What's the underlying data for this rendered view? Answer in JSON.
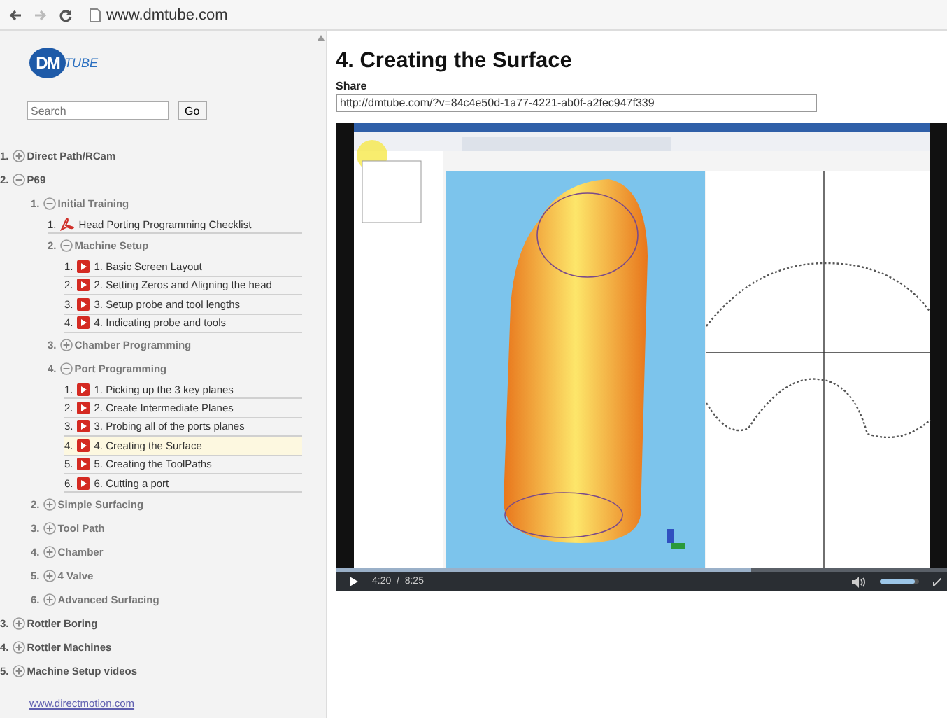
{
  "browser": {
    "url": "www.dmtube.com"
  },
  "sidebar": {
    "logo": {
      "text_1": "DM",
      "text_2": "TUBE"
    },
    "search": {
      "placeholder": "Search",
      "button": "Go"
    },
    "tree": [
      {
        "number": "1.",
        "label": "Direct Path/RCam",
        "kind": "folder",
        "expanded": false,
        "selected": false
      },
      {
        "number": "2.",
        "label": "P69",
        "kind": "folder",
        "expanded": true,
        "selected": false,
        "children": [
          {
            "number": "1.",
            "label": "Initial Training",
            "kind": "folder",
            "expanded": true,
            "selected": false,
            "children": [
              {
                "number": "1.",
                "label": "Head Porting Programming Checklist",
                "kind": "pdf",
                "selected": false
              },
              {
                "number": "2.",
                "label": "Machine Setup",
                "kind": "folder",
                "expanded": true,
                "selected": false,
                "children": [
                  {
                    "number": "1.",
                    "label": "1. Basic Screen Layout",
                    "kind": "video",
                    "selected": false
                  },
                  {
                    "number": "2.",
                    "label": "2. Setting Zeros and Aligning the head",
                    "kind": "video",
                    "selected": false
                  },
                  {
                    "number": "3.",
                    "label": "3. Setup probe and tool lengths",
                    "kind": "video",
                    "selected": false
                  },
                  {
                    "number": "4.",
                    "label": "4. Indicating probe and tools",
                    "kind": "video",
                    "selected": false
                  }
                ]
              },
              {
                "number": "3.",
                "label": "Chamber Programming",
                "kind": "folder",
                "expanded": false,
                "selected": false
              },
              {
                "number": "4.",
                "label": "Port Programming",
                "kind": "folder",
                "expanded": true,
                "selected": false,
                "children": [
                  {
                    "number": "1.",
                    "label": "1. Picking up the 3 key planes",
                    "kind": "video",
                    "selected": false
                  },
                  {
                    "number": "2.",
                    "label": "2. Create Intermediate Planes",
                    "kind": "video",
                    "selected": false
                  },
                  {
                    "number": "3.",
                    "label": "3. Probing all of the ports planes",
                    "kind": "video",
                    "selected": false
                  },
                  {
                    "number": "4.",
                    "label": "4. Creating the Surface",
                    "kind": "video",
                    "selected": true
                  },
                  {
                    "number": "5.",
                    "label": "5. Creating the ToolPaths",
                    "kind": "video",
                    "selected": false
                  },
                  {
                    "number": "6.",
                    "label": "6. Cutting a port",
                    "kind": "video",
                    "selected": false
                  }
                ]
              }
            ]
          },
          {
            "number": "2.",
            "label": "Simple Surfacing",
            "kind": "folder",
            "expanded": false,
            "selected": false
          },
          {
            "number": "3.",
            "label": "Tool Path",
            "kind": "folder",
            "expanded": false,
            "selected": false
          },
          {
            "number": "4.",
            "label": "Chamber",
            "kind": "folder",
            "expanded": false,
            "selected": false
          },
          {
            "number": "5.",
            "label": "4 Valve",
            "kind": "folder",
            "expanded": false,
            "selected": false
          },
          {
            "number": "6.",
            "label": "Advanced Surfacing",
            "kind": "folder",
            "expanded": false,
            "selected": false
          }
        ]
      },
      {
        "number": "3.",
        "label": "Rottler Boring",
        "kind": "folder",
        "expanded": false,
        "selected": false
      },
      {
        "number": "4.",
        "label": "Rottler Machines",
        "kind": "folder",
        "expanded": false,
        "selected": false
      },
      {
        "number": "5.",
        "label": "Machine Setup videos",
        "kind": "folder",
        "expanded": false,
        "selected": false
      }
    ],
    "link": "www.directmotion.com"
  },
  "main": {
    "title": "4. Creating the Surface",
    "share_label": "Share",
    "share_url": "http://dmtube.com/?v=84c4e50d-1a77-4221-ab0f-a2fec947f339",
    "player": {
      "time": "4:20  /  8:25",
      "progress": {
        "level": 0.68
      },
      "volume": {
        "level": 0.9
      }
    }
  }
}
